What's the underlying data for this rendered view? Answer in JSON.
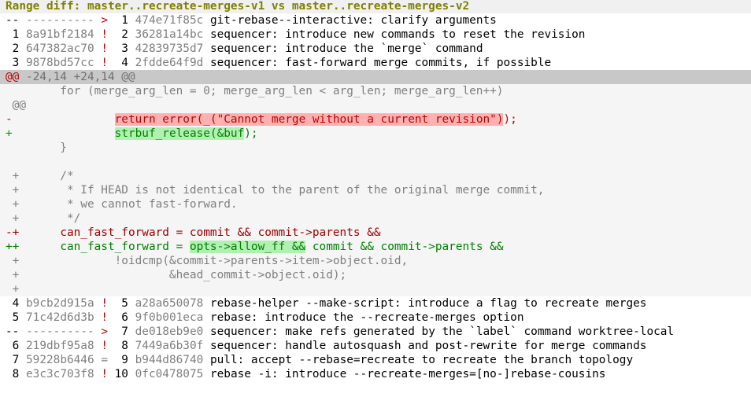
{
  "title": "Range diff: master..recreate-merges-v1 vs master..recreate-merges-v2",
  "top_rows": [
    {
      "l_num": "--",
      "l_oid": "----------",
      "sym": ">",
      "r_num": "1",
      "r_oid": "474e71f85c",
      "msg": "git-rebase--interactive: clarify arguments",
      "sym_color": "#c00000"
    },
    {
      "l_num": "1",
      "l_oid": "8a91bf2184",
      "sym": "!",
      "r_num": "2",
      "r_oid": "36281a14bc",
      "msg": "sequencer: introduce new commands to reset the revision",
      "sym_color": "#c00000"
    },
    {
      "l_num": "2",
      "l_oid": "647382ac70",
      "sym": "!",
      "r_num": "3",
      "r_oid": "42839735d7",
      "msg": "sequencer: introduce the `merge` command",
      "sym_color": "#c00000"
    },
    {
      "l_num": "3",
      "l_oid": "9878bd57cc",
      "sym": "!",
      "r_num": "4",
      "r_oid": "2fdde64f9d",
      "msg": "sequencer: fast-forward merge commits, if possible",
      "sym_color": "#c00000"
    }
  ],
  "hunk": {
    "marker": "@@",
    "text": " -24,14 +24,14 @@"
  },
  "diff": {
    "l1": "        for (merge_arg_len = 0; merge_arg_len < arg_len; merge_arg_len++)",
    "l2": " @@",
    "l3_prefix": "-",
    "l3_indent": "               ",
    "l3_hl": "return error(_(\"Cannot merge without a current revision\")",
    "l3_tail": ");",
    "l4_prefix": "+",
    "l4_indent": "               ",
    "l4_hl": "strbuf_release(&buf",
    "l4_tail": ");",
    "l5": "        }",
    "l6": "",
    "l7": " +      /*",
    "l8": " +       * If HEAD is not identical to the parent of the original merge commit,",
    "l9": " +       * we cannot fast-forward.",
    "l10": " +       */",
    "l11_prefix": "-+      ",
    "l11_body": "can_fast_forward = commit && commit->parents &&",
    "l12_prefix": "++      ",
    "l12_a": "can_fast_forward = ",
    "l12_hl": "opts->allow_ff &&",
    "l12_b": " commit && commit->parents &&",
    "l13": " +              !oidcmp(&commit->parents->item->object.oid,",
    "l14": " +                      &head_commit->object.oid);",
    "l15": " +"
  },
  "bottom_rows": [
    {
      "l_num": "4",
      "l_oid": "b9cb2d915a",
      "sym": "!",
      "r_num": "5",
      "r_oid": "a28a650078",
      "msg": "rebase-helper --make-script: introduce a flag to recreate merges",
      "sym_color": "#c00000"
    },
    {
      "l_num": "5",
      "l_oid": "71c42d6d3b",
      "sym": "!",
      "r_num": "6",
      "r_oid": "9f0b001eca",
      "msg": "rebase: introduce the --recreate-merges option",
      "sym_color": "#c00000"
    },
    {
      "l_num": "--",
      "l_oid": "----------",
      "sym": ">",
      "r_num": "7",
      "r_oid": "de018eb9e0",
      "msg": "sequencer: make refs generated by the `label` command worktree-local",
      "sym_color": "#c00000"
    },
    {
      "l_num": "6",
      "l_oid": "219dbf95a8",
      "sym": "!",
      "r_num": "8",
      "r_oid": "7449a6b30f",
      "msg": "sequencer: handle autosquash and post-rewrite for merge commands",
      "sym_color": "#c00000"
    },
    {
      "l_num": "7",
      "l_oid": "59228b6446",
      "sym": "=",
      "r_num": "9",
      "r_oid": "b944d86740",
      "msg": "pull: accept --rebase=recreate to recreate the branch topology",
      "sym_color": "#7f7f7f"
    },
    {
      "l_num": "8",
      "l_oid": "e3c3c703f8",
      "sym": "!",
      "r_num": "10",
      "r_oid": "0fc0478075",
      "msg": "rebase -i: introduce --recreate-merges=[no-]rebase-cousins",
      "sym_color": "#c00000"
    }
  ]
}
